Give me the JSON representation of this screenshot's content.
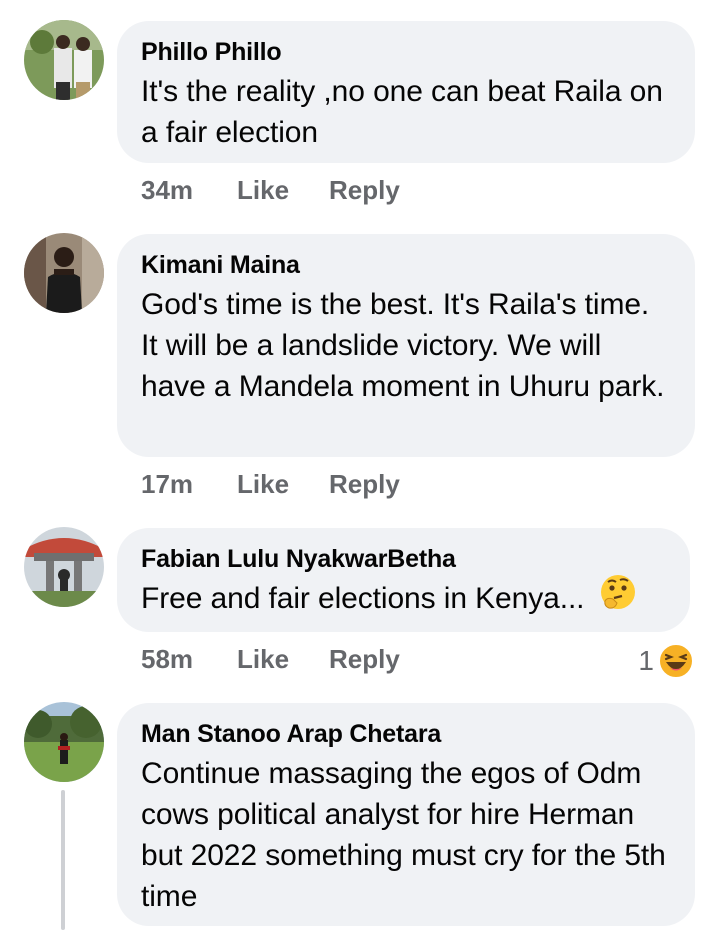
{
  "comments": [
    {
      "author": "Phillo Phillo",
      "text": "It's the reality ,no one can beat Raila on a fair election",
      "time": "34m",
      "like_label": "Like",
      "reply_label": "Reply"
    },
    {
      "author": "Kimani Maina",
      "text": "God's time is the best. It's Raila's time. It will be a landslide victory. We will have a Mandela moment in Uhuru park.",
      "time": "17m",
      "like_label": "Like",
      "reply_label": "Reply"
    },
    {
      "author": "Fabian Lulu NyakwarBetha",
      "text": "Free and fair elections in Kenya...",
      "emoji": "thinking-face-emoji",
      "time": "58m",
      "like_label": "Like",
      "reply_label": "Reply",
      "reaction_count": "1",
      "reaction_icon": "haha-reaction-icon"
    },
    {
      "author": "Man Stanoo Arap Chetara",
      "text": "Continue massaging the egos of Odm cows political analyst for hire Herman but 2022 something must cry for the 5th time"
    }
  ],
  "colors": {
    "bubble_bg": "#f0f2f5",
    "meta_text": "#65676b",
    "author_text": "#050505",
    "thread_line": "#ced0d4",
    "reaction_yellow": "#f7b125"
  }
}
